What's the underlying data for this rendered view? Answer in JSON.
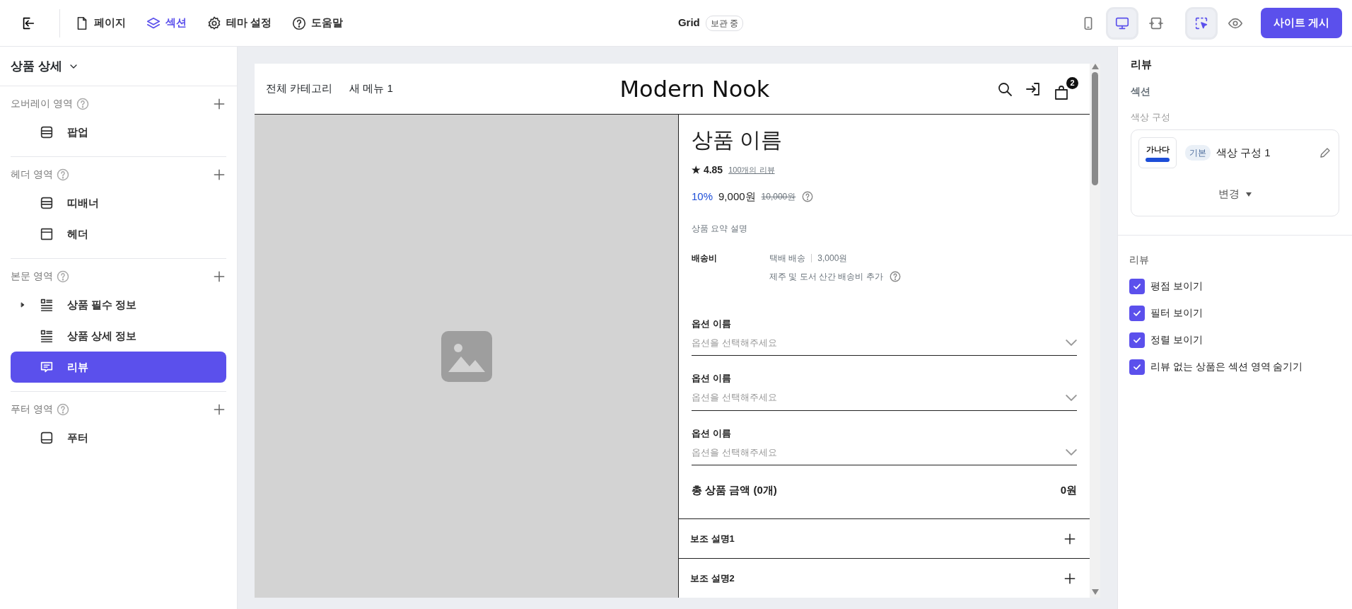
{
  "top_bar": {
    "tabs": [
      {
        "label": "페이지",
        "selected": false
      },
      {
        "label": "섹션",
        "selected": true
      },
      {
        "label": "테마 설정",
        "selected": false
      },
      {
        "label": "도움말",
        "selected": false
      }
    ],
    "title": "Grid",
    "status": "보관 중",
    "devices": [
      {
        "kind": "mobile",
        "selected": false
      },
      {
        "kind": "desktop",
        "selected": true
      },
      {
        "kind": "fit",
        "selected": false
      }
    ],
    "select_mode": {
      "on": true
    },
    "publish_button": "사이트 게시"
  },
  "sidebar": {
    "page_title": "상품 상세",
    "groups": [
      {
        "title": "오버레이 영역",
        "items": [
          {
            "label": "팝업",
            "kind": "banner",
            "expandable": false,
            "selected": false
          }
        ]
      },
      {
        "title": "헤더 영역",
        "items": [
          {
            "label": "띠배너",
            "kind": "banner",
            "expandable": false,
            "selected": false
          },
          {
            "label": "헤더",
            "kind": "header",
            "expandable": false,
            "selected": false
          }
        ]
      },
      {
        "title": "본문 영역",
        "items": [
          {
            "label": "상품 필수 정보",
            "kind": "list",
            "expandable": true,
            "selected": false
          },
          {
            "label": "상품 상세 정보",
            "kind": "list",
            "expandable": false,
            "selected": false
          },
          {
            "label": "리뷰",
            "kind": "review",
            "expandable": false,
            "selected": true
          }
        ]
      },
      {
        "title": "푸터 영역",
        "items": [
          {
            "label": "푸터",
            "kind": "footer",
            "expandable": false,
            "selected": false
          }
        ]
      }
    ]
  },
  "preview": {
    "nav": [
      "전체 카테고리",
      "새 메뉴 1"
    ],
    "logo": "Modern Nook",
    "cart_count": "2",
    "product": {
      "name": "상품 이름",
      "star": "★",
      "rating": "4.85",
      "reviews_link": "100개의 리뷰",
      "discount": "10%",
      "price": "9,000원",
      "original_price": "10,000원",
      "summary": "상품 요약 설명",
      "shipping": {
        "label": "배송비",
        "method": "택배 배송",
        "fee": "3,000원",
        "note": "제주 및 도서 산간 배송비 추가"
      },
      "options": [
        {
          "label": "옵션 이름",
          "placeholder": "옵션을 선택해주세요"
        },
        {
          "label": "옵션 이름",
          "placeholder": "옵션을 선택해주세요"
        },
        {
          "label": "옵션 이름",
          "placeholder": "옵션을 선택해주세요"
        }
      ],
      "total": {
        "label": "총 상품 금액 (0개)",
        "value": "0원"
      },
      "accordions": [
        "보조 설명1",
        "보조 설명2"
      ]
    }
  },
  "settings": {
    "title": "리뷰",
    "subtitle": "섹션",
    "color_label": "색상 구성",
    "color_scheme": {
      "sample": "가나다",
      "tag": "기본",
      "name": "색상 구성 1",
      "change_button": "변경"
    },
    "review_heading": "리뷰",
    "options": [
      {
        "label": "평점 보이기",
        "checked": true
      },
      {
        "label": "필터 보이기",
        "checked": true
      },
      {
        "label": "정렬 보이기",
        "checked": true
      },
      {
        "label": "리뷰 없는 상품은 섹션 영역 숨기기",
        "checked": true
      }
    ]
  }
}
